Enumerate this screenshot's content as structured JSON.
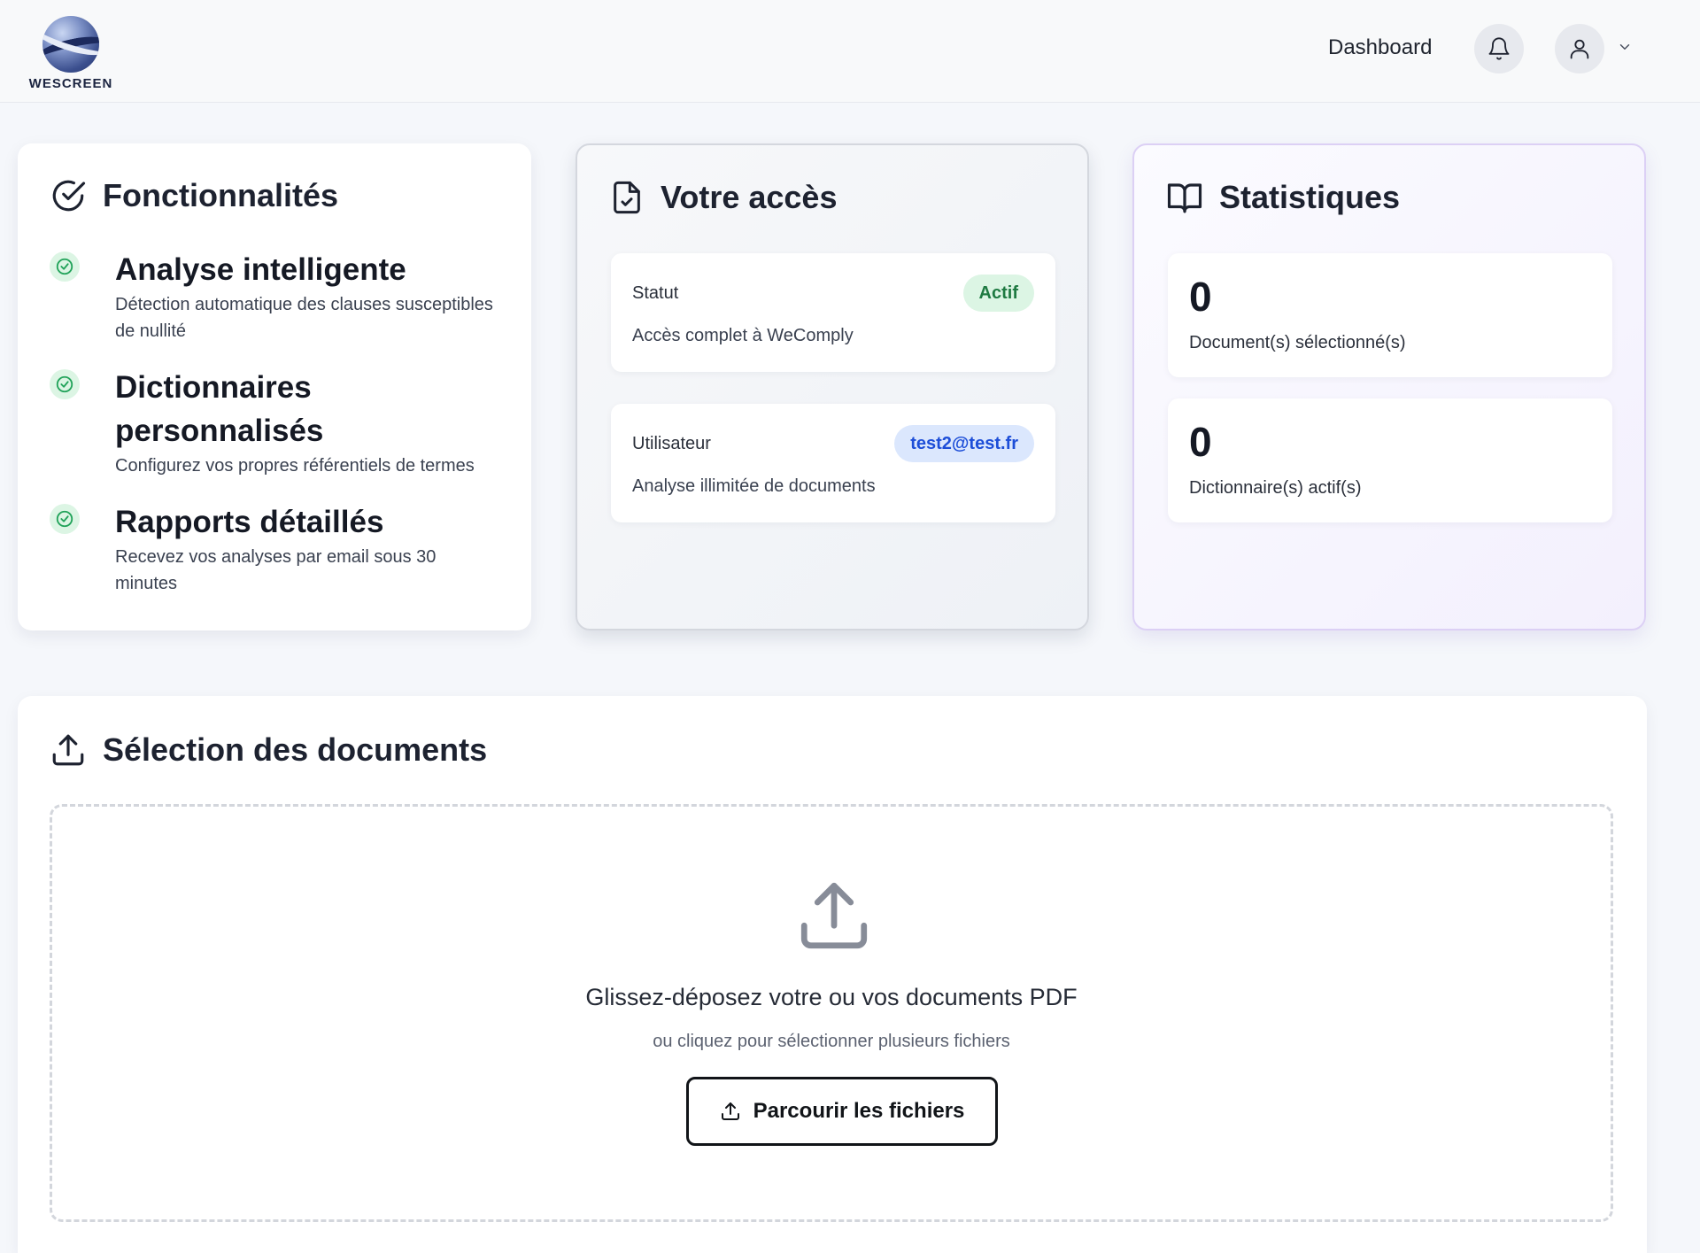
{
  "header": {
    "logo_text": "WESCREEN",
    "nav_dashboard": "Dashboard"
  },
  "features": {
    "title": "Fonctionnalités",
    "items": [
      {
        "title": "Analyse intelligente",
        "description": "Détection automatique des clauses susceptibles de nullité"
      },
      {
        "title": "Dictionnaires personnalisés",
        "description": "Configurez vos propres référentiels de termes"
      },
      {
        "title": "Rapports détaillés",
        "description": "Recevez vos analyses par email sous 30 minutes"
      }
    ]
  },
  "access": {
    "title": "Votre accès",
    "status_label": "Statut",
    "status_badge": "Actif",
    "status_desc": "Accès complet à WeComply",
    "user_label": "Utilisateur",
    "user_email": "test2@test.fr",
    "user_desc": "Analyse illimitée de documents"
  },
  "stats": {
    "title": "Statistiques",
    "items": [
      {
        "value": "0",
        "label": "Document(s) sélectionné(s)"
      },
      {
        "value": "0",
        "label": "Dictionnaire(s) actif(s)"
      }
    ]
  },
  "upload": {
    "title": "Sélection des documents",
    "drop_main": "Glissez-déposez votre ou vos documents PDF",
    "drop_sub": "ou cliquez pour sélectionner plusieurs fichiers",
    "browse_label": "Parcourir les fichiers"
  },
  "colors": {
    "success": "#1f7a42",
    "success_bg": "#dcf5e4",
    "info": "#1d4ed8",
    "info_bg": "#dbe7fd",
    "stats_border": "#dcd0f5"
  }
}
